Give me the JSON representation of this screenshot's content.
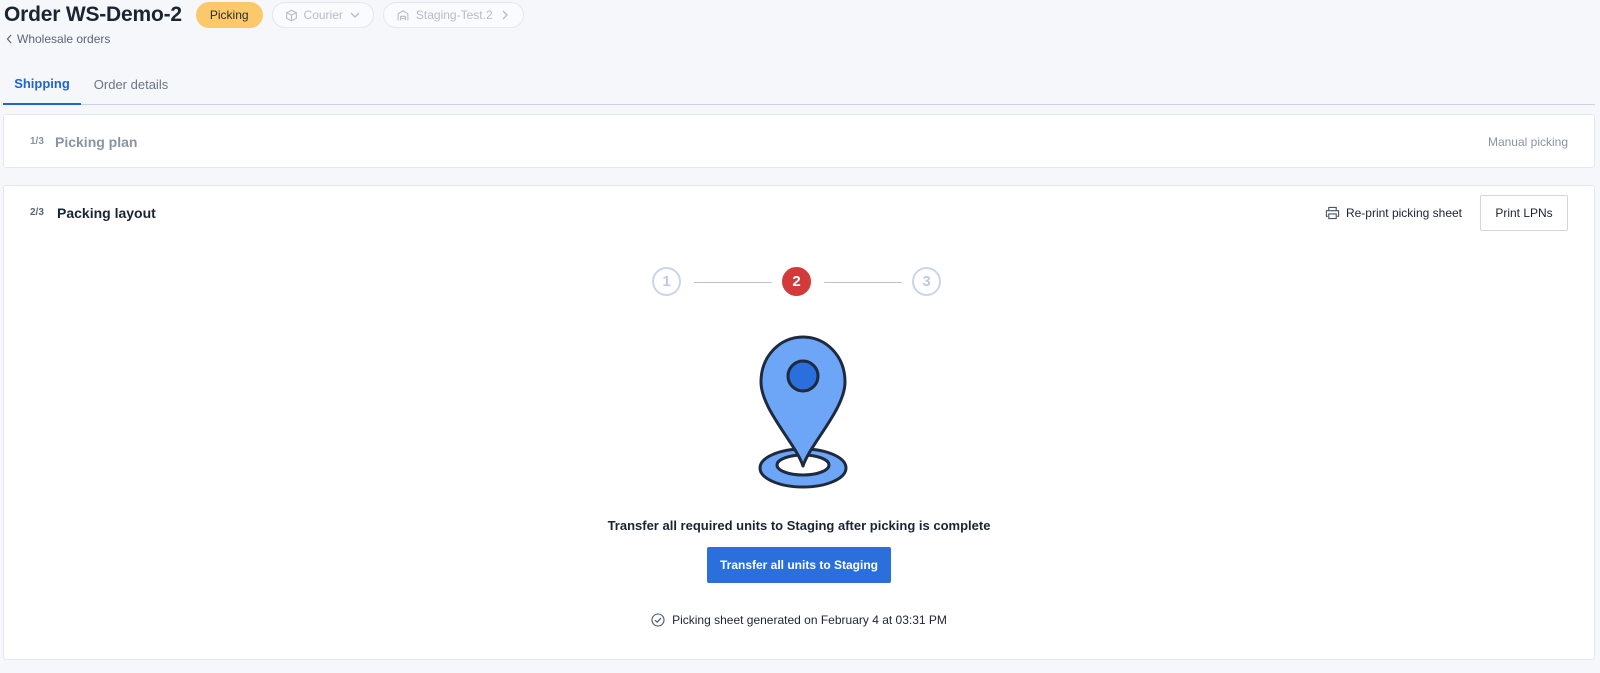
{
  "header": {
    "title": "Order WS-Demo-2",
    "status": "Picking",
    "carrier": "Courier",
    "location": "Staging-Test.2"
  },
  "breadcrumb": {
    "back_label": "Wholesale orders"
  },
  "tabs": [
    {
      "label": "Shipping",
      "active": true
    },
    {
      "label": "Order details",
      "active": false
    }
  ],
  "picking_plan": {
    "step": "1/3",
    "title": "Picking plan",
    "mode": "Manual picking"
  },
  "packing_layout": {
    "step": "2/3",
    "title": "Packing layout",
    "reprint_label": "Re-print picking sheet",
    "print_lpns_label": "Print LPNs",
    "stepper": [
      "1",
      "2",
      "3"
    ],
    "active_step": 2,
    "message": "Transfer all required units to Staging after picking is complete",
    "action_label": "Transfer all units to Staging",
    "footnote": "Picking sheet generated on February 4 at 03:31 PM"
  },
  "icons": {
    "status_pill": "box-icon",
    "location_pill": "warehouse-icon",
    "print": "printer-icon",
    "success": "check-circle-icon",
    "illustration": "map-pin-illustration"
  },
  "colors": {
    "accent": "#1f64d6",
    "primary_button": "#2a6fdb",
    "status_badge": "#fcc96a",
    "active_step": "#d33a3a",
    "pin_fill": "#6ea6f7",
    "pin_dot": "#2a6fdb"
  }
}
